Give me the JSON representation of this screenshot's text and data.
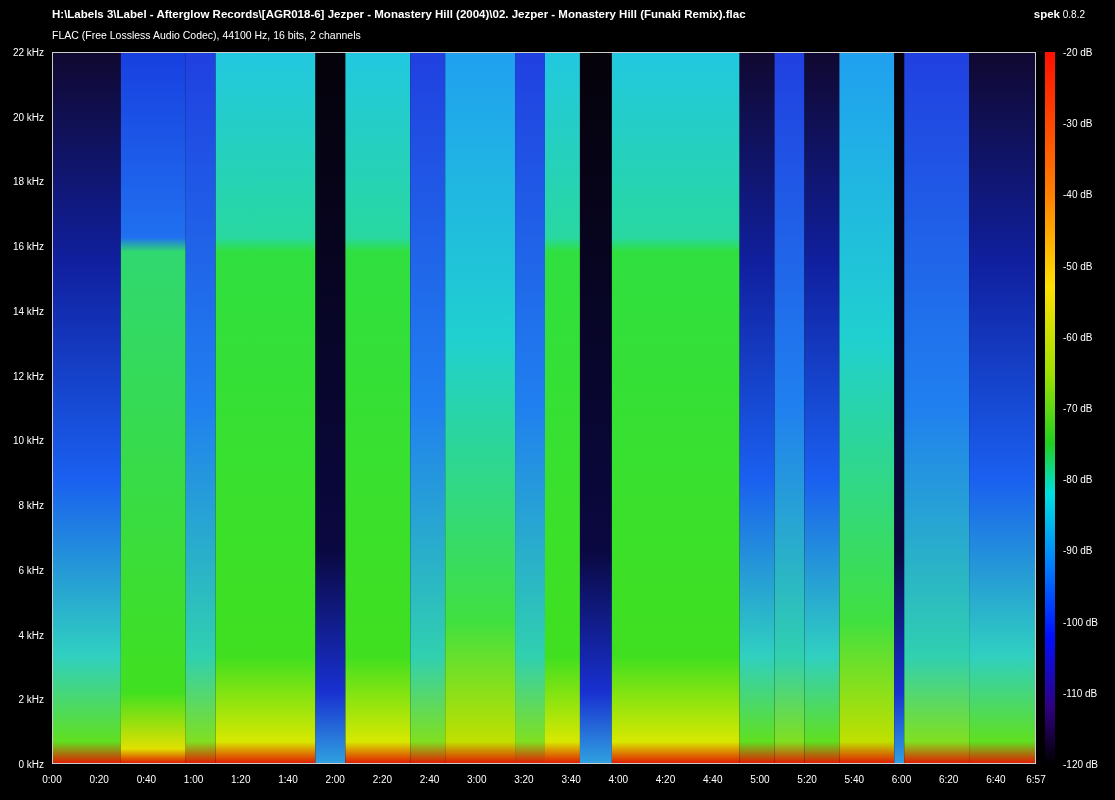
{
  "header": {
    "file_path": "H:\\Labels 3\\Label - Afterglow Records\\[AGR018-6] Jezper - Monastery Hill (2004)\\02. Jezper - Monastery Hill (Funaki Remix).flac",
    "app_name": "spek",
    "app_version": "0.8.2",
    "stream_info": "FLAC (Free Lossless Audio Codec), 44100 Hz, 16 bits, 2 channels"
  },
  "frequency_axis": [
    "22 kHz",
    "20 kHz",
    "18 kHz",
    "16 kHz",
    "14 kHz",
    "12 kHz",
    "10 kHz",
    "8 kHz",
    "6 kHz",
    "4 kHz",
    "2 kHz",
    "0 kHz"
  ],
  "time_axis": [
    "0:00",
    "0:20",
    "0:40",
    "1:00",
    "1:20",
    "1:40",
    "2:00",
    "2:20",
    "2:40",
    "3:00",
    "3:20",
    "3:40",
    "4:00",
    "4:20",
    "4:40",
    "5:00",
    "5:20",
    "5:40",
    "6:00",
    "6:20",
    "6:40",
    "6:57"
  ],
  "level_scale": [
    "-20 dB",
    "-30 dB",
    "-40 dB",
    "-50 dB",
    "-60 dB",
    "-70 dB",
    "-80 dB",
    "-90 dB",
    "-100 dB",
    "-110 dB",
    "-120 dB"
  ]
}
